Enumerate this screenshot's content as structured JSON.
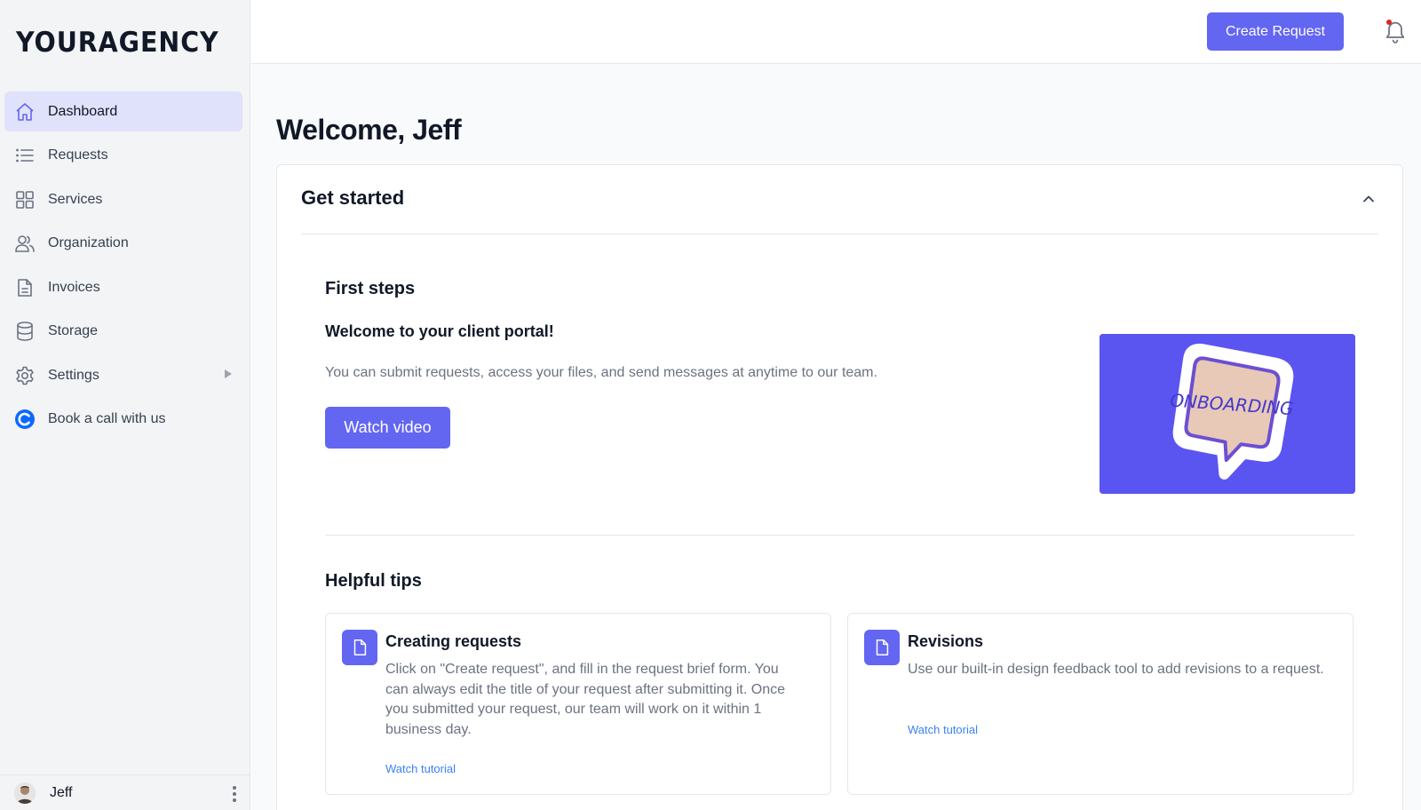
{
  "sidebar": {
    "logo": "YOURAGENCY",
    "items": [
      {
        "label": "Dashboard",
        "icon": "home-icon",
        "active": true
      },
      {
        "label": "Requests",
        "icon": "list-icon"
      },
      {
        "label": "Services",
        "icon": "grid-icon"
      },
      {
        "label": "Organization",
        "icon": "users-icon"
      },
      {
        "label": "Invoices",
        "icon": "document-icon"
      },
      {
        "label": "Storage",
        "icon": "database-icon"
      },
      {
        "label": "Settings",
        "icon": "gear-icon",
        "has_submenu": true
      },
      {
        "label": "Book a call with us",
        "icon": "calendly-icon"
      }
    ],
    "user": {
      "name": "Jeff"
    }
  },
  "topbar": {
    "create_label": "Create Request",
    "notification_icon": "bell-icon",
    "has_unread": true
  },
  "main": {
    "title": "Welcome, Jeff",
    "get_started": {
      "heading": "Get started",
      "first_steps": {
        "heading": "First steps",
        "subheading": "Welcome to your client portal!",
        "description": "You can submit requests, access your files, and send messages at anytime to our team.",
        "button_label": "Watch video",
        "thumbnail_text": "ONBOARDING"
      },
      "helpful_tips": {
        "heading": "Helpful tips",
        "tips": [
          {
            "title": "Creating requests",
            "body": "Click on \"Create request\", and fill in the request brief form. You can always edit the title of your request after submitting it. Once you submitted your request, our team will work on it within 1 business day.",
            "link": "Watch tutorial",
            "icon": "file-icon"
          },
          {
            "title": "Revisions",
            "body": "Use our built-in design feedback tool to add revisions to a request.",
            "link": "Watch tutorial",
            "icon": "file-icon"
          }
        ]
      }
    }
  },
  "colors": {
    "accent": "#6366f1",
    "active_nav": "#e0e1fb",
    "link": "#3b82f6"
  }
}
